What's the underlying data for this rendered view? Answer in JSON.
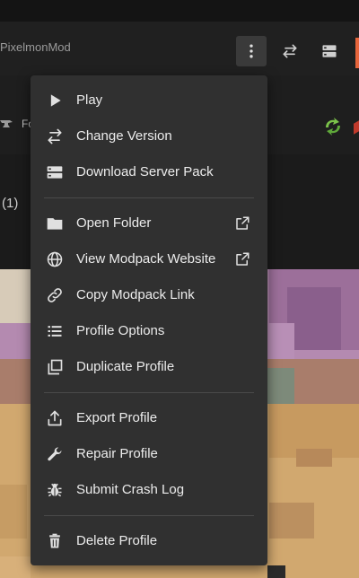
{
  "header": {
    "title": "PixelmonMod",
    "icons": [
      "more-vert-icon",
      "swap-icon",
      "server-icon"
    ]
  },
  "subbar": {
    "loader_text": "Fo"
  },
  "main": {
    "count_text": "(1)"
  },
  "menu": {
    "items": [
      {
        "label": "Play",
        "icon": "play-icon"
      },
      {
        "label": "Change Version",
        "icon": "swap-icon"
      },
      {
        "label": "Download Server Pack",
        "icon": "server-icon"
      },
      {
        "label": "Open Folder",
        "icon": "folder-icon",
        "external": true
      },
      {
        "label": "View Modpack Website",
        "icon": "globe-icon",
        "external": true
      },
      {
        "label": "Copy Modpack Link",
        "icon": "link-icon"
      },
      {
        "label": "Profile Options",
        "icon": "list-icon"
      },
      {
        "label": "Duplicate Profile",
        "icon": "duplicate-icon"
      },
      {
        "label": "Export Profile",
        "icon": "export-icon"
      },
      {
        "label": "Repair Profile",
        "icon": "wrench-icon"
      },
      {
        "label": "Submit Crash Log",
        "icon": "bug-icon"
      },
      {
        "label": "Delete Profile",
        "icon": "trash-icon"
      }
    ]
  },
  "colors": {
    "accent": "#e8663c",
    "menu_bg": "#303030",
    "header_bg": "#202020"
  }
}
